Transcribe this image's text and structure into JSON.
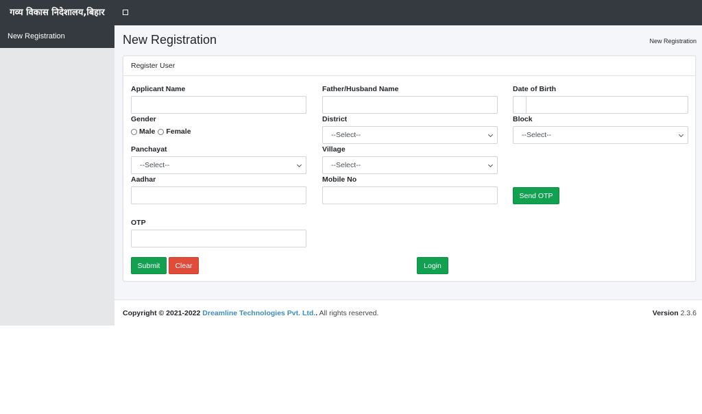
{
  "topbar": {
    "brand": "गव्य विकास निदेशालय,बिहार",
    "menu_toggle_icon": "square-icon"
  },
  "sidebar": {
    "items": [
      {
        "label": "New Registration",
        "active": true
      }
    ]
  },
  "header": {
    "title": "New Registration",
    "breadcrumb": "New Registration"
  },
  "form": {
    "card_title": "Register User",
    "applicant_name": {
      "label": "Applicant Name",
      "value": ""
    },
    "father_name": {
      "label": "Father/Husband Name",
      "value": ""
    },
    "dob": {
      "label": "Date of Birth",
      "value": ""
    },
    "gender": {
      "label": "Gender",
      "options": [
        "Male",
        "Female"
      ],
      "selected": null
    },
    "district": {
      "label": "District",
      "selected": "--Select--"
    },
    "block": {
      "label": "Block",
      "selected": "--Select--"
    },
    "panchayat": {
      "label": "Panchayat",
      "selected": "--Select--"
    },
    "village": {
      "label": "Village",
      "selected": "--Select--"
    },
    "aadhar": {
      "label": "Aadhar",
      "value": ""
    },
    "mobile": {
      "label": "Mobile No",
      "value": ""
    },
    "send_otp": "Send OTP",
    "otp": {
      "label": "OTP",
      "value": ""
    },
    "submit": "Submit",
    "clear": "Clear",
    "login": "Login"
  },
  "footer": {
    "copyright_prefix": "Copyright © 2021-2022",
    "company": "Dreamline Technologies Pvt. Ltd.",
    "company_suffix": ".",
    "rights": "All rights reserved.",
    "version_label": "Version",
    "version_value": "2.3.6"
  },
  "colors": {
    "topbar": "#343a40",
    "success": "#12a150",
    "danger": "#e04b3a",
    "link": "#3c8dbc"
  }
}
